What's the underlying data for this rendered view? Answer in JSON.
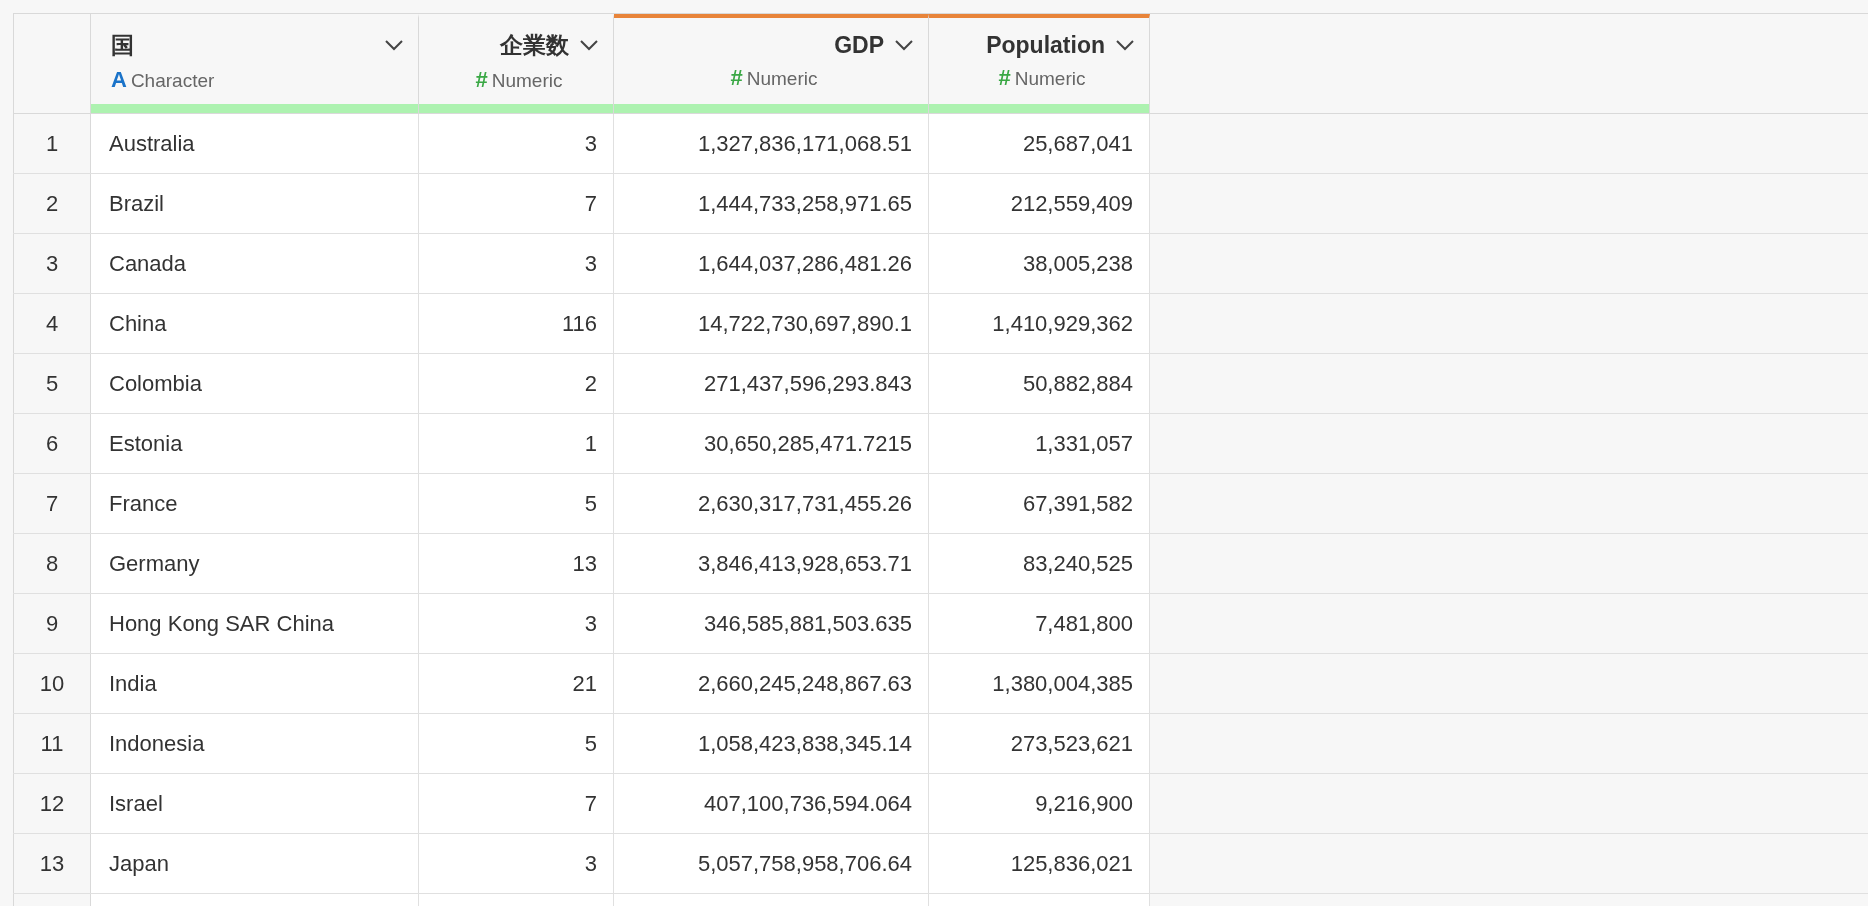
{
  "columns": [
    {
      "name": "国",
      "kind": "character",
      "type_icon": "A",
      "type": "Character",
      "selected": false,
      "level": 1
    },
    {
      "name": "企業数",
      "kind": "numeric",
      "type_icon": "#",
      "type": "Numeric",
      "selected": false,
      "level": 1
    },
    {
      "name": "GDP",
      "kind": "numeric",
      "type_icon": "#",
      "type": "Numeric",
      "selected": true,
      "level": 1
    },
    {
      "name": "Population",
      "kind": "numeric",
      "type_icon": "#",
      "type": "Numeric",
      "selected": true,
      "level": 1
    }
  ],
  "rows": [
    {
      "index": "1",
      "cells": [
        "Australia",
        "3",
        "1,327,836,171,068.51",
        "25,687,041"
      ]
    },
    {
      "index": "2",
      "cells": [
        "Brazil",
        "7",
        "1,444,733,258,971.65",
        "212,559,409"
      ]
    },
    {
      "index": "3",
      "cells": [
        "Canada",
        "3",
        "1,644,037,286,481.26",
        "38,005,238"
      ]
    },
    {
      "index": "4",
      "cells": [
        "China",
        "116",
        "14,722,730,697,890.1",
        "1,410,929,362"
      ]
    },
    {
      "index": "5",
      "cells": [
        "Colombia",
        "2",
        "271,437,596,293.843",
        "50,882,884"
      ]
    },
    {
      "index": "6",
      "cells": [
        "Estonia",
        "1",
        "30,650,285,471.7215",
        "1,331,057"
      ]
    },
    {
      "index": "7",
      "cells": [
        "France",
        "5",
        "2,630,317,731,455.26",
        "67,391,582"
      ]
    },
    {
      "index": "8",
      "cells": [
        "Germany",
        "13",
        "3,846,413,928,653.71",
        "83,240,525"
      ]
    },
    {
      "index": "9",
      "cells": [
        "Hong Kong SAR China",
        "3",
        "346,585,881,503.635",
        "7,481,800"
      ]
    },
    {
      "index": "10",
      "cells": [
        "India",
        "21",
        "2,660,245,248,867.63",
        "1,380,004,385"
      ]
    },
    {
      "index": "11",
      "cells": [
        "Indonesia",
        "5",
        "1,058,423,838,345.14",
        "273,523,621"
      ]
    },
    {
      "index": "12",
      "cells": [
        "Israel",
        "7",
        "407,100,736,594.064",
        "9,216,900"
      ]
    },
    {
      "index": "13",
      "cells": [
        "Japan",
        "3",
        "5,057,758,958,706.64",
        "125,836,021"
      ]
    }
  ]
}
